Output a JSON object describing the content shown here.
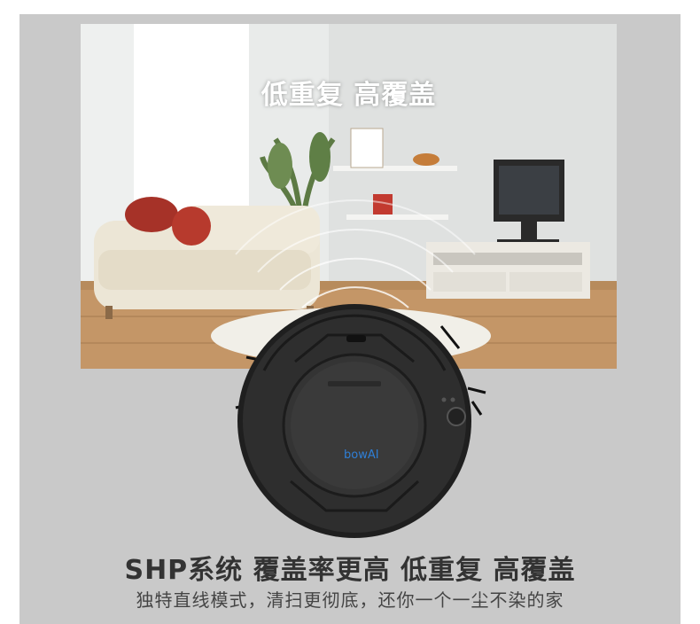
{
  "photo": {
    "title": "低重复 高覆盖"
  },
  "robot": {
    "brand_logo": "bowAI"
  },
  "headline": "SHP系统 覆盖率更高 低重复 高覆盖",
  "subline": "独特直线模式，清扫更彻底，还你一个一尘不染的家",
  "colors": {
    "panel": "#c9c9c9",
    "robot_body": "#2b2b2b",
    "logo_blue": "#2f7fd6",
    "headline": "#333333"
  }
}
